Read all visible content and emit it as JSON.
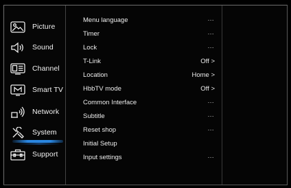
{
  "sidebar": {
    "items": [
      {
        "label": "Picture",
        "icon": "picture-icon"
      },
      {
        "label": "Sound",
        "icon": "speaker-icon"
      },
      {
        "label": "Channel",
        "icon": "channel-icon"
      },
      {
        "label": "Smart TV",
        "icon": "smart-tv-icon"
      },
      {
        "label": "Network",
        "icon": "network-icon"
      },
      {
        "label": "System",
        "icon": "tools-icon"
      },
      {
        "label": "Support",
        "icon": "toolbox-icon"
      }
    ],
    "selected": "System",
    "accent_color": "#2a86e0"
  },
  "submenu": {
    "items": [
      {
        "label": "Menu language",
        "value": "...",
        "arrow": ""
      },
      {
        "label": "Timer",
        "value": "...",
        "arrow": ""
      },
      {
        "label": "Lock",
        "value": "...",
        "arrow": ""
      },
      {
        "label": "T-Link",
        "value": "Off",
        "arrow": ">"
      },
      {
        "label": "Location",
        "value": "Home",
        "arrow": ">"
      },
      {
        "label": "HbbTV mode",
        "value": "Off",
        "arrow": ">"
      },
      {
        "label": "Common Interface",
        "value": "...",
        "arrow": ""
      },
      {
        "label": "Subtitle",
        "value": "...",
        "arrow": ""
      },
      {
        "label": "Reset shop",
        "value": "...",
        "arrow": ""
      },
      {
        "label": "Initial Setup",
        "value": "",
        "arrow": ""
      },
      {
        "label": "Input settings",
        "value": "...",
        "arrow": ""
      }
    ]
  }
}
